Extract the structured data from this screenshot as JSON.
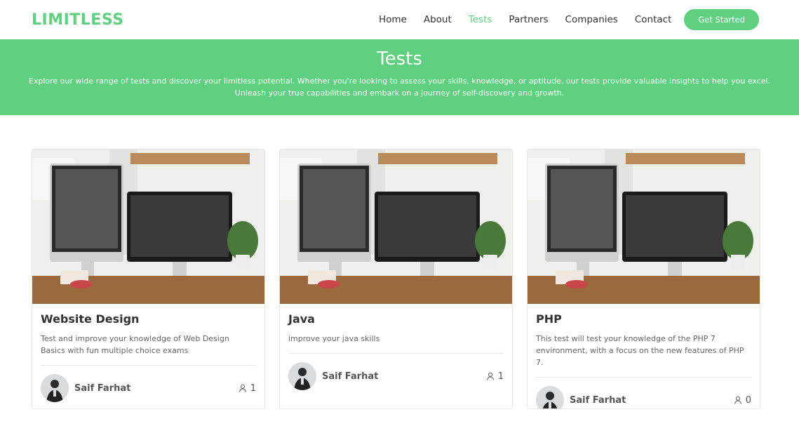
{
  "brand": {
    "logo": "LIMITLESS",
    "accent_color": "#5fd07f"
  },
  "nav": {
    "items": [
      {
        "label": "Home",
        "active": false
      },
      {
        "label": "About",
        "active": false
      },
      {
        "label": "Tests",
        "active": true
      },
      {
        "label": "Partners",
        "active": false
      },
      {
        "label": "Companies",
        "active": false
      },
      {
        "label": "Contact",
        "active": false
      }
    ],
    "cta_label": "Get Started"
  },
  "hero": {
    "title": "Tests",
    "description": "Explore our wide range of tests and discover your limitless potential. Whether you're looking to assess your skills, knowledge, or aptitude, our tests provide valuable insights to help you excel. Unleash your true capabilities and embark on a journey of self-discovery and growth."
  },
  "cards": [
    {
      "title": "Website Design",
      "description": "Test and improve your knowledge of Web Design Basics with fun multiple choice exams",
      "author": "Saif Farhat",
      "participants": "1",
      "image_icon": "desk-computers-photo",
      "user_icon": "user-icon"
    },
    {
      "title": "Java",
      "description": "improve your java skills",
      "author": "Saif Farhat",
      "participants": "1",
      "image_icon": "desk-computers-photo",
      "user_icon": "user-icon"
    },
    {
      "title": "PHP",
      "description": "This test will test your knowledge of the PHP 7 environment, with a focus on the new features of PHP 7.",
      "author": "Saif Farhat",
      "participants": "0",
      "image_icon": "desk-computers-photo",
      "user_icon": "user-icon"
    }
  ]
}
